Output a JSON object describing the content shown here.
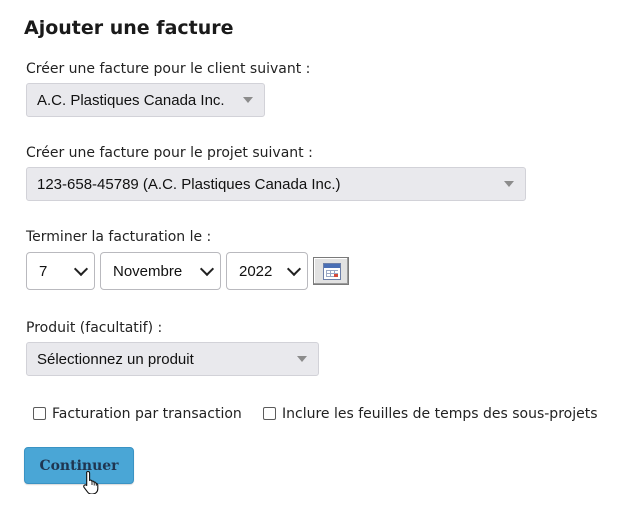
{
  "title": "Ajouter une facture",
  "client": {
    "label": "Créer une facture pour le client suivant :",
    "value": "A.C. Plastiques Canada Inc."
  },
  "project": {
    "label": "Créer une facture pour le projet suivant :",
    "value": "123-658-45789 (A.C. Plastiques Canada Inc.)"
  },
  "end_date": {
    "label": "Terminer la facturation le :",
    "day": "7",
    "month": "Novembre",
    "year": "2022"
  },
  "product": {
    "label": "Produit (facultatif) :",
    "value": "Sélectionnez un produit"
  },
  "options": {
    "per_transaction": {
      "label": "Facturation par transaction",
      "checked": false
    },
    "include_subprojects": {
      "label": "Inclure les feuilles de temps des sous-projets",
      "checked": false
    }
  },
  "continue_label": "Continuer",
  "colors": {
    "button": "#4aa6d6",
    "button_text": "#1f3550",
    "select_bg": "#e9e9ed"
  },
  "icons": {
    "calendar": "calendar-icon",
    "cursor": "hand-pointer-cursor"
  }
}
